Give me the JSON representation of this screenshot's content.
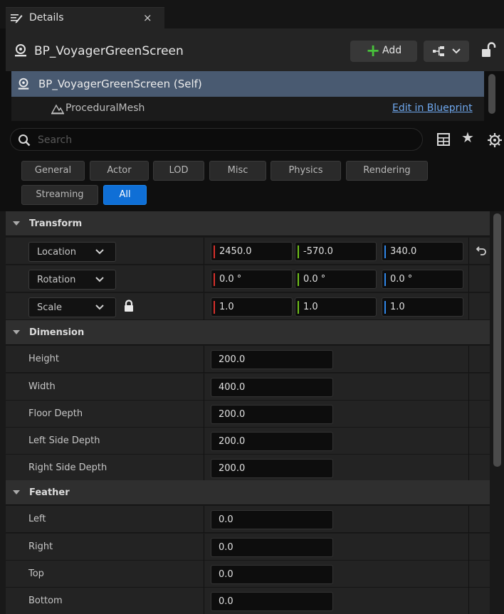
{
  "tab": {
    "label": "Details",
    "close": "×"
  },
  "header": {
    "title": "BP_VoyagerGreenScreen",
    "add_label": "Add"
  },
  "tree": {
    "self_label": "BP_VoyagerGreenScreen (Self)",
    "child_label": "ProceduralMesh",
    "edit_link": "Edit in Blueprint"
  },
  "search": {
    "placeholder": "Search",
    "value": ""
  },
  "filters": [
    "General",
    "Actor",
    "LOD",
    "Misc",
    "Physics",
    "Rendering",
    "Streaming",
    "All"
  ],
  "active_filter": "All",
  "transform": {
    "label": "Transform",
    "location": {
      "label": "Location",
      "x": "2450.0",
      "y": "-570.0",
      "z": "340.0"
    },
    "rotation": {
      "label": "Rotation",
      "x": "0.0 °",
      "y": "0.0 °",
      "z": "0.0 °"
    },
    "scale": {
      "label": "Scale",
      "x": "1.0",
      "y": "1.0",
      "z": "1.0"
    }
  },
  "dimension": {
    "label": "Dimension",
    "rows": [
      {
        "name": "Height",
        "value": "200.0"
      },
      {
        "name": "Width",
        "value": "400.0"
      },
      {
        "name": "Floor Depth",
        "value": "200.0"
      },
      {
        "name": "Left Side Depth",
        "value": "200.0"
      },
      {
        "name": "Right Side Depth",
        "value": "200.0"
      }
    ]
  },
  "feather": {
    "label": "Feather",
    "rows": [
      {
        "name": "Left",
        "value": "0.0"
      },
      {
        "name": "Right",
        "value": "0.0"
      },
      {
        "name": "Top",
        "value": "0.0"
      },
      {
        "name": "Bottom",
        "value": "0.0"
      }
    ]
  },
  "colors": {
    "axis_x": "#d8302b",
    "axis_y": "#6fbf1a",
    "axis_z": "#2f86e8",
    "accent": "#0f6fd6",
    "selection": "#495a71",
    "link": "#6fa8ee",
    "add_plus": "#48c23b"
  },
  "icons": {
    "tab": "details-icon",
    "actor": "actor-icon",
    "mesh": "procedural-mesh-icon",
    "search": "search-icon",
    "grid": "table-view-icon",
    "star": "favorite-star-icon",
    "settings": "gear-icon",
    "lock": "lock-icon",
    "reset": "reset-arrow-icon"
  }
}
